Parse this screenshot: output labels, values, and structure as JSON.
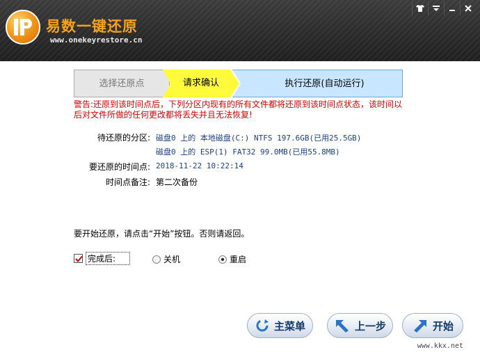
{
  "header": {
    "title": "易数一键还原",
    "url": "www.onekeyrestore.cn",
    "window_controls": [
      "shirt-icon",
      "menu-icon",
      "minimize-icon",
      "close-icon"
    ]
  },
  "steps": [
    {
      "label": "选择还原点",
      "state": "done"
    },
    {
      "label": "请求确认",
      "state": "active"
    },
    {
      "label": "执行还原(自动运行)",
      "state": "pending"
    }
  ],
  "warning": "警告:还原到该时间点后，下列分区内现有的所有文件都将还原到该时间点状态，该时间以后对文件所做的任何更改都将丢失并且无法恢复!",
  "info": {
    "partition_label": "待还原的分区:",
    "partitions": [
      "磁盘0 上的 本地磁盘(C:) NTFS 197.6GB(已用25.5GB)",
      "磁盘0 上的 ESP(1) FAT32 99.0MB(已用55.8MB)"
    ],
    "time_label": "要还原的时间点:",
    "time_value": "2018-11-22 10:22:14",
    "note_label": "时间点备注:",
    "note_value": "第二次备份"
  },
  "prompt": "要开始还原，请点击“开始”按钮。否则请返回。",
  "after": {
    "label": "完成后:",
    "checked": true,
    "options": [
      {
        "label": "关机",
        "selected": false
      },
      {
        "label": "重启",
        "selected": true
      }
    ]
  },
  "buttons": {
    "main_menu": "主菜单",
    "prev": "上一步",
    "start": "开始"
  },
  "watermark": "www.kkx.net",
  "colors": {
    "accent_orange": "#f7a11a",
    "warning_red": "#e00000",
    "active_step": "#fffb3c",
    "pending_step": "#c8e6ff",
    "value_blue": "#1a3f8a"
  }
}
